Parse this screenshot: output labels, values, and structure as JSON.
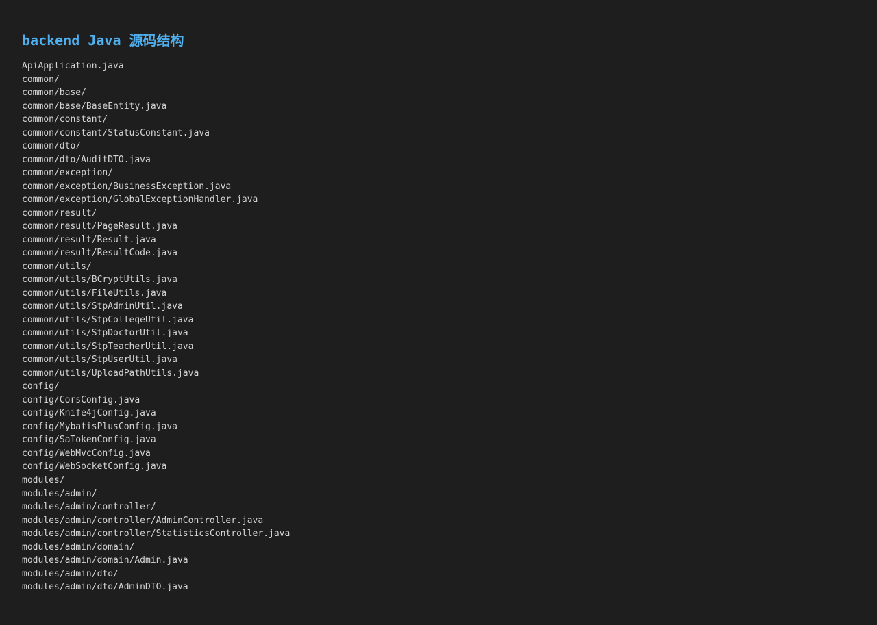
{
  "title": "backend Java 源码结构",
  "files": [
    "ApiApplication.java",
    "common/",
    "common/base/",
    "common/base/BaseEntity.java",
    "common/constant/",
    "common/constant/StatusConstant.java",
    "common/dto/",
    "common/dto/AuditDTO.java",
    "common/exception/",
    "common/exception/BusinessException.java",
    "common/exception/GlobalExceptionHandler.java",
    "common/result/",
    "common/result/PageResult.java",
    "common/result/Result.java",
    "common/result/ResultCode.java",
    "common/utils/",
    "common/utils/BCryptUtils.java",
    "common/utils/FileUtils.java",
    "common/utils/StpAdminUtil.java",
    "common/utils/StpCollegeUtil.java",
    "common/utils/StpDoctorUtil.java",
    "common/utils/StpTeacherUtil.java",
    "common/utils/StpUserUtil.java",
    "common/utils/UploadPathUtils.java",
    "config/",
    "config/CorsConfig.java",
    "config/Knife4jConfig.java",
    "config/MybatisPlusConfig.java",
    "config/SaTokenConfig.java",
    "config/WebMvcConfig.java",
    "config/WebSocketConfig.java",
    "modules/",
    "modules/admin/",
    "modules/admin/controller/",
    "modules/admin/controller/AdminController.java",
    "modules/admin/controller/StatisticsController.java",
    "modules/admin/domain/",
    "modules/admin/domain/Admin.java",
    "modules/admin/dto/",
    "modules/admin/dto/AdminDTO.java"
  ],
  "colors": {
    "background": "#1e1e1e",
    "title": "#4fb0f0",
    "text": "#d4d4d4"
  }
}
